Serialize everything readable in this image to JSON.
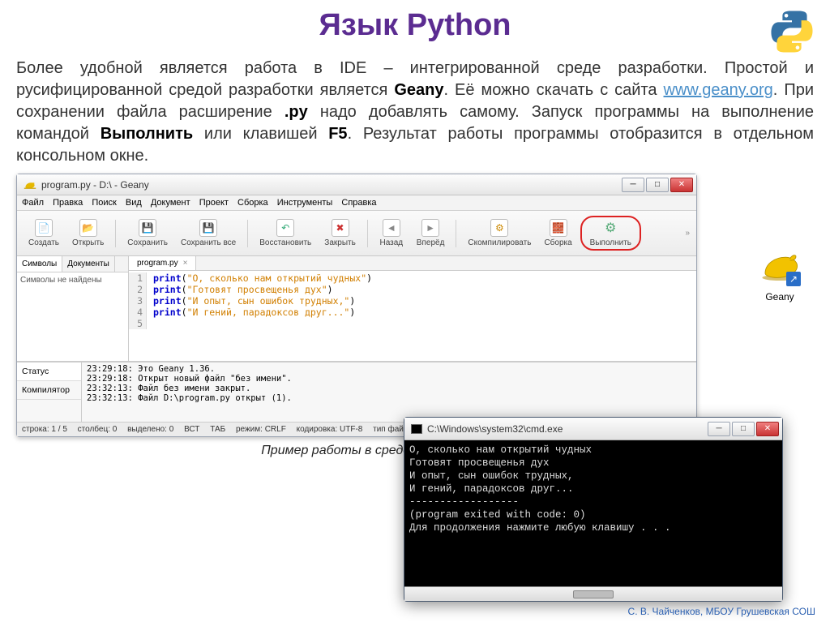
{
  "slide": {
    "title": "Язык Python",
    "p1a": "Более удобной является работа в IDE – интегрированной среде разработки. Простой и русифицированной средой разработки является ",
    "p1_geany": "Geany",
    "p1b": ". Её можно скачать с сайта ",
    "p1_link": "www.geany.org",
    "p1c": ". При сохранении файла расширение ",
    "p1_py": ".py",
    "p1d": " надо добавлять самому. Запуск программы на выполнение командой ",
    "p1_run": "Выполнить",
    "p1e": " или клавишей ",
    "p1_f5": "F5",
    "p1f": ". Результат работы программы отобразится в отдельном консольном окне.",
    "caption": "Пример работы в среде Geany",
    "credit": "С. В. Чайченков, МБОУ Грушевская СОШ"
  },
  "shortcut": {
    "label": "Geany"
  },
  "geany": {
    "title": "program.py - D:\\ - Geany",
    "menu": [
      "Файл",
      "Правка",
      "Поиск",
      "Вид",
      "Документ",
      "Проект",
      "Сборка",
      "Инструменты",
      "Справка"
    ],
    "toolbar": {
      "create": "Создать",
      "open": "Открыть",
      "save": "Сохранить",
      "saveall": "Сохранить все",
      "restore": "Восстановить",
      "close": "Закрыть",
      "back": "Назад",
      "forward": "Вперёд",
      "compile": "Скомпилировать",
      "build": "Сборка",
      "run": "Выполнить"
    },
    "side": {
      "tab_symbols": "Символы",
      "tab_docs": "Документы",
      "empty": "Символы не найдены"
    },
    "editor": {
      "filename": "program.py",
      "lines": [
        {
          "n": "1",
          "kw": "print",
          "str": "\"О, сколько нам открытий чудных\""
        },
        {
          "n": "2",
          "kw": "print",
          "str": "\"Готовят просвещенья дух\""
        },
        {
          "n": "3",
          "kw": "print",
          "str": "\"И опыт, сын ошибок трудных,\""
        },
        {
          "n": "4",
          "kw": "print",
          "str": "\"И гений, парадоксов друг...\""
        },
        {
          "n": "5",
          "kw": "",
          "str": ""
        }
      ]
    },
    "bottom": {
      "tab_status": "Статус",
      "tab_compiler": "Компилятор",
      "msgs": [
        "23:29:18: Это Geany 1.36.",
        "23:29:18: Открыт новый файл \"без имени\".",
        "23:32:13: Файл без имени закрыт.",
        "23:32:13: Файл D:\\program.py открыт (1)."
      ]
    },
    "status": {
      "pos": "строка: 1 / 5",
      "col": "столбец: 0",
      "sel": "выделено: 0",
      "ins": "ВСТ",
      "tab": "ТАБ",
      "crlf": "режим: CRLF",
      "enc": "кодировка: UTF-8",
      "ftype": "тип файл"
    }
  },
  "cmd": {
    "title": "C:\\Windows\\system32\\cmd.exe",
    "lines": [
      "О, сколько нам открытий чудных",
      "Готовят просвещенья дух",
      "И опыт, сын ошибок трудных,",
      "И гений, парадоксов друг...",
      "",
      "------------------",
      "(program exited with code: 0)",
      "",
      "Для продолжения нажмите любую клавишу . . ."
    ]
  }
}
